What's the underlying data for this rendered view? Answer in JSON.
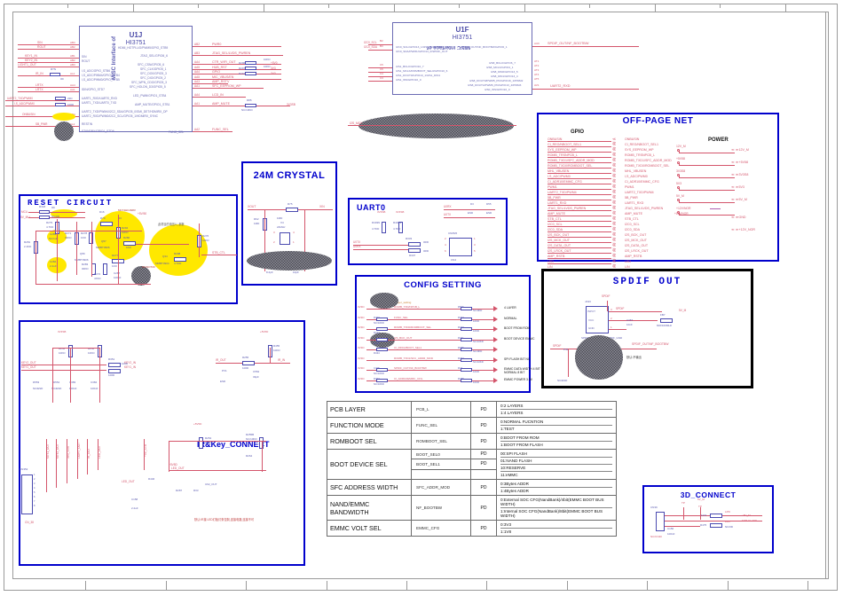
{
  "sheet": {
    "zone_labels_top": [
      "",
      "",
      "",
      "",
      "",
      "",
      ""
    ],
    "zone_labels_bottom": [
      "",
      "",
      "",
      "",
      "",
      "",
      ""
    ]
  },
  "ic_u1j": {
    "designator": "U1J",
    "part": "HI3751",
    "side_label": "MISC Interface of",
    "left_pins": [
      "SIN",
      "ROUT",
      "I,S_ADC/GPIO_STB6",
      "I,S_ADC/PWM4/GPIO_STB4",
      "I,S_ADC/PWM0/GPIO_STB5",
      "IDIN/GPIO_STD7",
      "UART1_RXD/UART0_RXD",
      "UART1_TXD/UART0_TXD",
      "UART2_TXD/PWM4/I2C2_SDA/GPIO5_0/SMI_DET/HDMIRX_DP",
      "UART2_RXD/PWM0/I2C2_SCL/GPIO5_1/HDMIRX_SYNC",
      "RESTIN",
      "STANDBY/GPIO1_STD6"
    ],
    "right_pins": [
      "HDMI_HOTPLUG/PWM5/GPIO_STB9",
      "JTAG_SEL/GPIO6_6",
      "SFC_CSN/GPIO5_6",
      "SFC_CLK/GPIO5_1",
      "SFC_DO0/GPIO5_3",
      "SFC_DIO/GPIO5_2",
      "SFC_WPN_CDO/GPIO5_3",
      "SFC_HOLDN_D3/GPIO5_5",
      "LED_PWM/GPIO1_STB4",
      "AMP_MUTE/GPIO1_STB1",
      "FUNC_SEL"
    ],
    "right_nets": [
      "PWR0",
      "JTAG_SEL/LVDS_PWREN",
      "CTR_WIFI_OUT",
      "HUB_RST",
      "GPIO",
      "MIC_VBUS/EN",
      "AMP_RSTV",
      "SFC_EEPROM_WP",
      "LCD_IN",
      "AMP_MUTE",
      "FUNC_SEL"
    ],
    "right_pinnos": [
      "AB2",
      "AB3",
      "AA4",
      "AA5",
      "AA4",
      "AA5",
      "AA3",
      "AA1",
      "AA4",
      "AA1",
      "AA2"
    ],
    "left_pinnos": [
      "AB3",
      "AB2",
      "AB1",
      "AB2",
      "AB3",
      "AA2",
      "AB3",
      "AA5",
      "AA7",
      "AA8",
      "AB4",
      "AA2"
    ],
    "left_nets": [
      "SIN",
      "ROUT",
      "KEY1_IN",
      "KEY2_IN",
      "LIGHT1_OUT",
      "IR_IN",
      "LRTX",
      "LRTX",
      "UART2_TXD/PWM0",
      "I,S_ADC/PWM0",
      "ONBUSIN",
      "SB_PWR"
    ]
  },
  "ic_u1f": {
    "designator": "U1F",
    "part": "HI3751",
    "side_label": "MISC interface of",
    "left_pins": [
      "I2C0_SCL/GPIO13_1/I2S1_DIN/SPDIF_OUT",
      "I2C0_SDA/PWM1/GPIO13_0/SPDIF_OUT",
      "I2S1_BCLK/GPIO10_7",
      "I2S1_MCLK/ROMBOOT_SEL0/GPIO10_6",
      "I2S1_DOUT0/GPIO10_1/I2S1_DIN1",
      "I2S1_WS/GPIO10_0"
    ],
    "right_pins": [
      "SPDIF_OUT/NF_BOOTBW/GPIO6_1",
      "I2S8_BCLK/GPIO6_7",
      "I2S8_MCLK/GPIO4_1",
      "I2S8_DIN0/GPIO13_5",
      "I2S8_DIN1/GPIO13_4",
      "I2S8_DOUT0/PWM5_PD/GPIO16_1/PWM2",
      "I2S8_DOUT1/PWM6_PD/GPIO13_4/PWM3",
      "I2S0_WS/GPIO10_0"
    ],
    "right_nets": [
      "SPDIF_OUT/NF_BOOTBW",
      "UART2_RXD"
    ],
    "left_nets": [
      "I2C0_SCL",
      "I2C0_SDA",
      "I2S1_BCLK",
      "I2S1_MCLK",
      "I2S1_DOUT0",
      "I2S1_WS"
    ],
    "right_pinnos": [
      "AU6",
      "AT1",
      "AT2",
      "AT3",
      "AT4",
      "AT5",
      "AV1",
      "AV1"
    ],
    "left_pinnos": [
      "B2",
      "B3",
      "C5",
      "C6",
      "C4",
      "C3"
    ]
  },
  "blocks": {
    "reset_circuit": {
      "title": "RESET CIRCUIT",
      "parts": [
        {
          "ref": "R318",
          "val": "0R"
        },
        {
          "ref": "R319",
          "val": "NC/0R"
        },
        {
          "ref": "R279",
          "val": "4.7KD"
        },
        {
          "ref": "R281",
          "val": "2.4KD"
        },
        {
          "ref": "C283",
          "val": "NC/1uF"
        },
        {
          "ref": "C284",
          "val": "2.2uF"
        },
        {
          "ref": "R271",
          "val": "30KD"
        },
        {
          "ref": "R278",
          "val": "1KD"
        },
        {
          "ref": "R283",
          "val": "10KD"
        },
        {
          "ref": "R272",
          "val": "47KD"
        },
        {
          "ref": "R277",
          "val": "1KD"
        },
        {
          "ref": "C287",
          "val": "100nF"
        },
        {
          "ref": "Q56",
          "val": "MMBT3906"
        },
        {
          "ref": "Q57",
          "val": "MMBT3906"
        },
        {
          "ref": "Q34",
          "val": "MMBT3904"
        },
        {
          "ref": "R70",
          "val": ""
        },
        {
          "ref": "R3",
          "val": ""
        },
        {
          "ref": "R294",
          "val": "10KD"
        },
        {
          "ref": "R280",
          "val": "1KD"
        },
        {
          "ref": "R298",
          "val": "4.7KD"
        },
        {
          "ref": "R276",
          "val": "10KD"
        },
        {
          "ref": "D16",
          "val": "MC74HC1N8V"
        },
        {
          "ref": "D17",
          "val": "NC/SOT23"
        }
      ],
      "nets": [
        "MCU",
        "5V_MU",
        "+3V3",
        "STB_CTL",
        "+5V/50"
      ],
      "note": "此项目的电压U_参数"
    },
    "crystal": {
      "title": "24M CRYSTAL",
      "parts": [
        {
          "ref": "R75",
          "val": ""
        },
        {
          "ref": "R62",
          "val": "1MD"
        },
        {
          "ref": "X4",
          "val": "24MHz"
        },
        {
          "ref": "C91",
          "val": "8.2pF"
        },
        {
          "ref": "C92",
          "val": "10pF"
        }
      ],
      "nets": [
        "XOUT",
        "XIN"
      ]
    },
    "uart0": {
      "title": "UART0",
      "parts": [
        {
          "ref": "R403N",
          "val": "4.7KD"
        },
        {
          "ref": "R402N",
          "val": "4.7KD"
        },
        {
          "ref": "R333",
          "val": "0R"
        },
        {
          "ref": "R334",
          "val": "0R"
        },
        {
          "ref": "D3",
          "val": "ESD"
        },
        {
          "ref": "D55",
          "val": "ESD"
        },
        {
          "ref": "CN4",
          "val": "CN65/6"
        }
      ],
      "nets": [
        "U0RX",
        "U0TX",
        "UDTX",
        "UDRX",
        "3V3/5B"
      ]
    },
    "offpage": {
      "title": "OFF-PAGE NET",
      "gpio_title": "GPIO",
      "power_title": "POWER",
      "gpio_left": [
        "ONBUSIN",
        "CI_REG/NBOOT_SEL1",
        "SYS_EEPROM_WP",
        "ROMB_TRSNPCB_L",
        "ROMB_TXD1/SFC_ADDR_MOD",
        "ROMB_TXD0/ROMBOOT_SEL",
        "MHL_VBUSEN",
        "I,S_ADC/PWM0",
        "CI_ADR10/EMMC_CFG",
        "PWM1",
        "UART2_TXD/PWM4",
        "5B_PWR",
        "UART1_RXD",
        "JTAG_SEL/LVDS_PWREN",
        "AMP_MUTE",
        "STB_CTL",
        "I2C0_SCL",
        "I2C0_SDA",
        "I2S_BCK_OUT",
        "I2S_MCK_OUT",
        "I2S_DATA_OUT",
        "I2S_LRCK_OUT",
        "AMP_RSTB",
        "LED",
        "LIN",
        "CTR_WIFI_OUT",
        "HUB_RST"
      ],
      "gpio_right": [
        "ONBUSIN",
        "CI_REG/NBOOT_SEL1",
        "SYS_EEPROM_WP",
        "ROMB_TRSNPCB_L",
        "ROMB_TXD1/SFC_ADDR_MOD",
        "ROMB_TXD0/ROMBOOT_SEL",
        "MHL_VBUSEN",
        "I,S_ADC/PWM0",
        "CI_ADR10/EMMC_CFG",
        "PWM1",
        "UART2_TXD/PWM4",
        "5B_PWR",
        "UART1_RXD",
        "JTAG_SEL/LVDS_PWREN",
        "AMP_MUTE",
        "STB_CTL",
        "I2C0_SCL",
        "I2C0_SDA",
        "I2S_BCK_OUT",
        "I2S_MCK_OUT",
        "I2S_DATA_OUT",
        "I2S_LRCK_OUT",
        "AMP_RSTB",
        "LED",
        "LIN",
        "CTR_WIFI_OUT",
        "HUB_RST"
      ],
      "power_sources": [
        "12V_M",
        "+5V58",
        "3V3S8",
        "5V3",
        "5V_M",
        "+12V/NOR"
      ],
      "power_ports": [
        "12V_M",
        "+5V58",
        "3V3S8",
        "5V3",
        "5V_M",
        "GND",
        "+12V_NOR"
      ]
    },
    "config": {
      "title": "CONFIG SETTING",
      "note": "Bor_Layer_setting",
      "rows": [
        {
          "signal": "ROMB_TXD/NPCB_L",
          "lres": "",
          "rres": "R506",
          "rval": "NC/0KD",
          "desc": "4 LAYER",
          "lnet": "3V3D"
        },
        {
          "signal": "FUNC_SEL",
          "lres": "R403",
          "lval": "NC/10KD",
          "rres": "R437",
          "rval": "10KD",
          "desc": "NORMAL",
          "lnet": "3V3D"
        },
        {
          "signal": "ROMB_TXD0/ROMBOOT_SEL",
          "lres": "R433",
          "rres": "R433",
          "rval": "10KD",
          "desc": "BOOT FROM ROM",
          "lnet": "3V3D"
        },
        {
          "signal": "I2S_BCK_OUT",
          "lres": "R435",
          "rres": "R431",
          "rval": "NC/10KD",
          "desc": "BOOT DEVICE EMMC",
          "lnet": "3V3D"
        },
        {
          "signal": "CI_RFDA/BOOT_SEL1",
          "lres": "R434",
          "rres": "R336",
          "rval": "NC/0KD",
          "desc": "",
          "lnet": "3V3D"
        },
        {
          "signal": "ROMB_TXD1/SFC_ADDR_MOD",
          "lres": "",
          "rres": "R457",
          "rval": "NC/10KD",
          "desc": "SPI FLASH BIT NC",
          "lnet": "3V3D"
        },
        {
          "signal": "SPDIF_OUT/NF_BOOTBW",
          "lres": "C405",
          "lval": "NC/10KD",
          "rres": "R44",
          "rval": "10KD",
          "desc": "EMMC DATA WIDTH 4 BIT NORMAL 8 BIT",
          "lnet": "3V3D"
        },
        {
          "signal": "CI_ADR10/EMMC_CFG",
          "lres": "R402",
          "lval": "NC/10KD",
          "rres": "R488",
          "rval": "10KD",
          "desc": "EMMC POWER 3.3V",
          "lnet": "3V3D"
        }
      ]
    },
    "spdif": {
      "title": "SPDIF OUT",
      "parts": [
        {
          "ref": "JA33",
          "val": ""
        },
        {
          "ref": "FB7",
          "val": "600/100MHz"
        },
        {
          "ref": "C357",
          "val": "10nF"
        },
        {
          "ref": "PJ2",
          "val": "NC/ESD"
        }
      ],
      "pins": [
        "INPUT",
        "VCC",
        "GND"
      ],
      "nets": [
        "SPDIF",
        "5V_M",
        "SPDIF_GND",
        "SPDIF_OUT/NF_BOOTBW"
      ],
      "note": "SPDIF SOCKET",
      "note2": "默认:不输出"
    },
    "irkey": {
      "title": "IR&Key_CONNECT",
      "parts": [
        {
          "ref": "R252",
          "val": "10KD"
        },
        {
          "ref": "R250",
          "val": "10KD"
        },
        {
          "ref": "R351",
          "val": "100D"
        },
        {
          "ref": "R352",
          "val": "100D"
        },
        {
          "ref": "D553",
          "val": "NC/ESD"
        },
        {
          "ref": "D554",
          "val": "NC/ESD"
        },
        {
          "ref": "C383",
          "val": "100nF"
        },
        {
          "ref": "C384",
          "val": "100nF"
        },
        {
          "ref": "R455",
          "val": "10KD"
        },
        {
          "ref": "R255",
          "val": "100D"
        },
        {
          "ref": "C552",
          "val": "33pF"
        },
        {
          "ref": "PV1",
          "val": "ESD"
        },
        {
          "ref": "R254",
          "val": "1.5KD"
        },
        {
          "ref": "R255B",
          "val": "NC/10KD"
        },
        {
          "ref": "R264",
          "val": ""
        },
        {
          "ref": "CN352",
          "val": ""
        },
        {
          "ref": "CN_38",
          "val": ""
        }
      ],
      "nets": [
        "KEY2_OUT",
        "KEY1_OUT",
        "KEY2_IN",
        "KEY1_IN",
        "IR_OUT",
        "IR_IN",
        "LED_OUT",
        "3V3SB",
        "+5V5D",
        "LIGHT_OUT",
        "3V3_STB"
      ],
      "note": "默认:IR接 LED灯板灯条控制,连接电路,连接不可"
    },
    "d3connect": {
      "title": "3D_CONNECT",
      "parts": [
        {
          "ref": "CN39",
          "val": ""
        },
        {
          "ref": "C150",
          "val": "100nF"
        },
        {
          "ref": "R474",
          "val": ""
        },
        {
          "ref": "R475",
          "val": "NC/0D"
        }
      ],
      "nets": [
        "5V_M",
        "TP",
        "LPD",
        "LFD",
        "+5V_M",
        "FOR GLASS",
        "NC/CN40"
      ]
    }
  },
  "spec_table": {
    "rows": [
      {
        "name": "PCB LAYER",
        "signal": "PCB_L",
        "pd": "PD",
        "values": [
          "0:2 LAYERS",
          "1:4 LAYERS"
        ]
      },
      {
        "name": "FUNCTION MODE",
        "signal": "FUNC_SEL",
        "pd": "PD",
        "values": [
          "0:NORMAL  FUCNTION",
          "1:TEST"
        ]
      },
      {
        "name": "ROMBOOT SEL",
        "signal": "ROMBOOT_SEL",
        "pd": "PD",
        "values": [
          "0:BOOT FROM ROM",
          "1:BOOT FROM FLASH"
        ]
      },
      {
        "name": "BOOT DEVICE SEL",
        "signal": "BOOT_SEL0",
        "signal2": "BOOT_SEL1",
        "pd": "PD",
        "values": [
          "00:SPI FLASH",
          "01:NAND FLASH",
          "10:RESERVE",
          "11:eMMC"
        ]
      },
      {
        "name": "SFC ADDRESS WIDTH",
        "signal": "SFC_ADDR_MOD",
        "pd": "PD",
        "values": [
          "0:3Bytes ADDR",
          "1:4Bytes ADDR"
        ]
      },
      {
        "name": "NAND/EMMC BANDWIDTH",
        "signal": "NF_BOOTBW",
        "pd": "PD",
        "values": [
          "0:External SOC CFG(NandBank)/4bit(EMMC BOOT BUS WIDTH)",
          "1:Internal SOC CFG(NandBank)/8bit(EMMC BOOT BUS WIDTH)"
        ]
      },
      {
        "name": "EMMC VOLT SEL",
        "signal": "EMMC_CFG",
        "pd": "PD",
        "values": [
          "0:3V3",
          "1:1V8"
        ]
      }
    ]
  }
}
